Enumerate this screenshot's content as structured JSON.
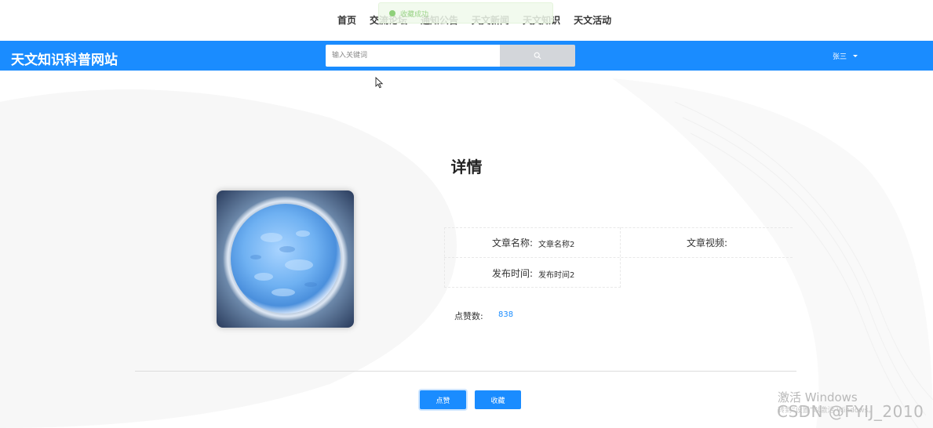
{
  "topnav": {
    "links": [
      "首页",
      "交流论坛",
      "通知公告",
      "天文新闻",
      "天文知识",
      "天文活动"
    ],
    "toast": "收藏成功"
  },
  "header": {
    "brand": "天文知识科普网站",
    "search_placeholder": "输入关键词",
    "user": "张三"
  },
  "detail": {
    "title": "详情",
    "fields": {
      "name_label": "文章名称:",
      "name_value": "文章名称2",
      "video_label": "文章视频:",
      "time_label": "发布时间:",
      "time_value": "发布时间2"
    },
    "likes_label": "点赞数:",
    "likes_value": "838"
  },
  "actions": {
    "like": "点赞",
    "favorite": "收藏"
  },
  "watermark": {
    "line1": "激活 Windows",
    "line2": "转到“设置”以激活 Windows。",
    "csdn": "CSDN @FYIJ_2010"
  },
  "colors": {
    "primary": "#1a8cff",
    "search_button": "#d3d6da",
    "toast_bg": "#f0f9eb"
  }
}
